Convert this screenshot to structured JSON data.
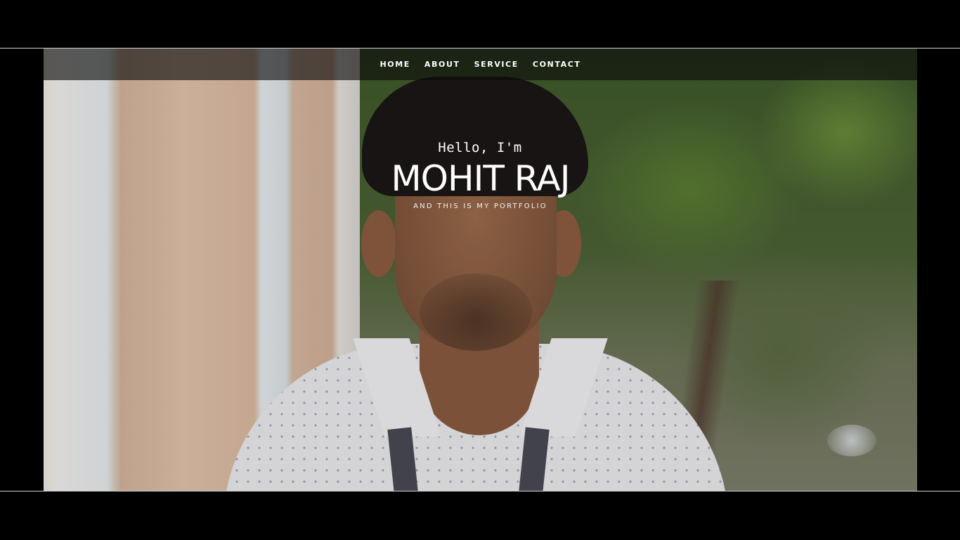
{
  "nav": {
    "items": [
      {
        "label": "HOME"
      },
      {
        "label": "ABOUT"
      },
      {
        "label": "SERVICE"
      },
      {
        "label": "CONTACT"
      }
    ]
  },
  "hero": {
    "greeting": "Hello, I'm",
    "name": "MOHIT RAJ",
    "tagline": "AND THIS IS MY PORTFOLIO"
  },
  "colors": {
    "page_background": "#000000",
    "nav_text": "#ffffff",
    "hero_text": "#ffffff"
  }
}
